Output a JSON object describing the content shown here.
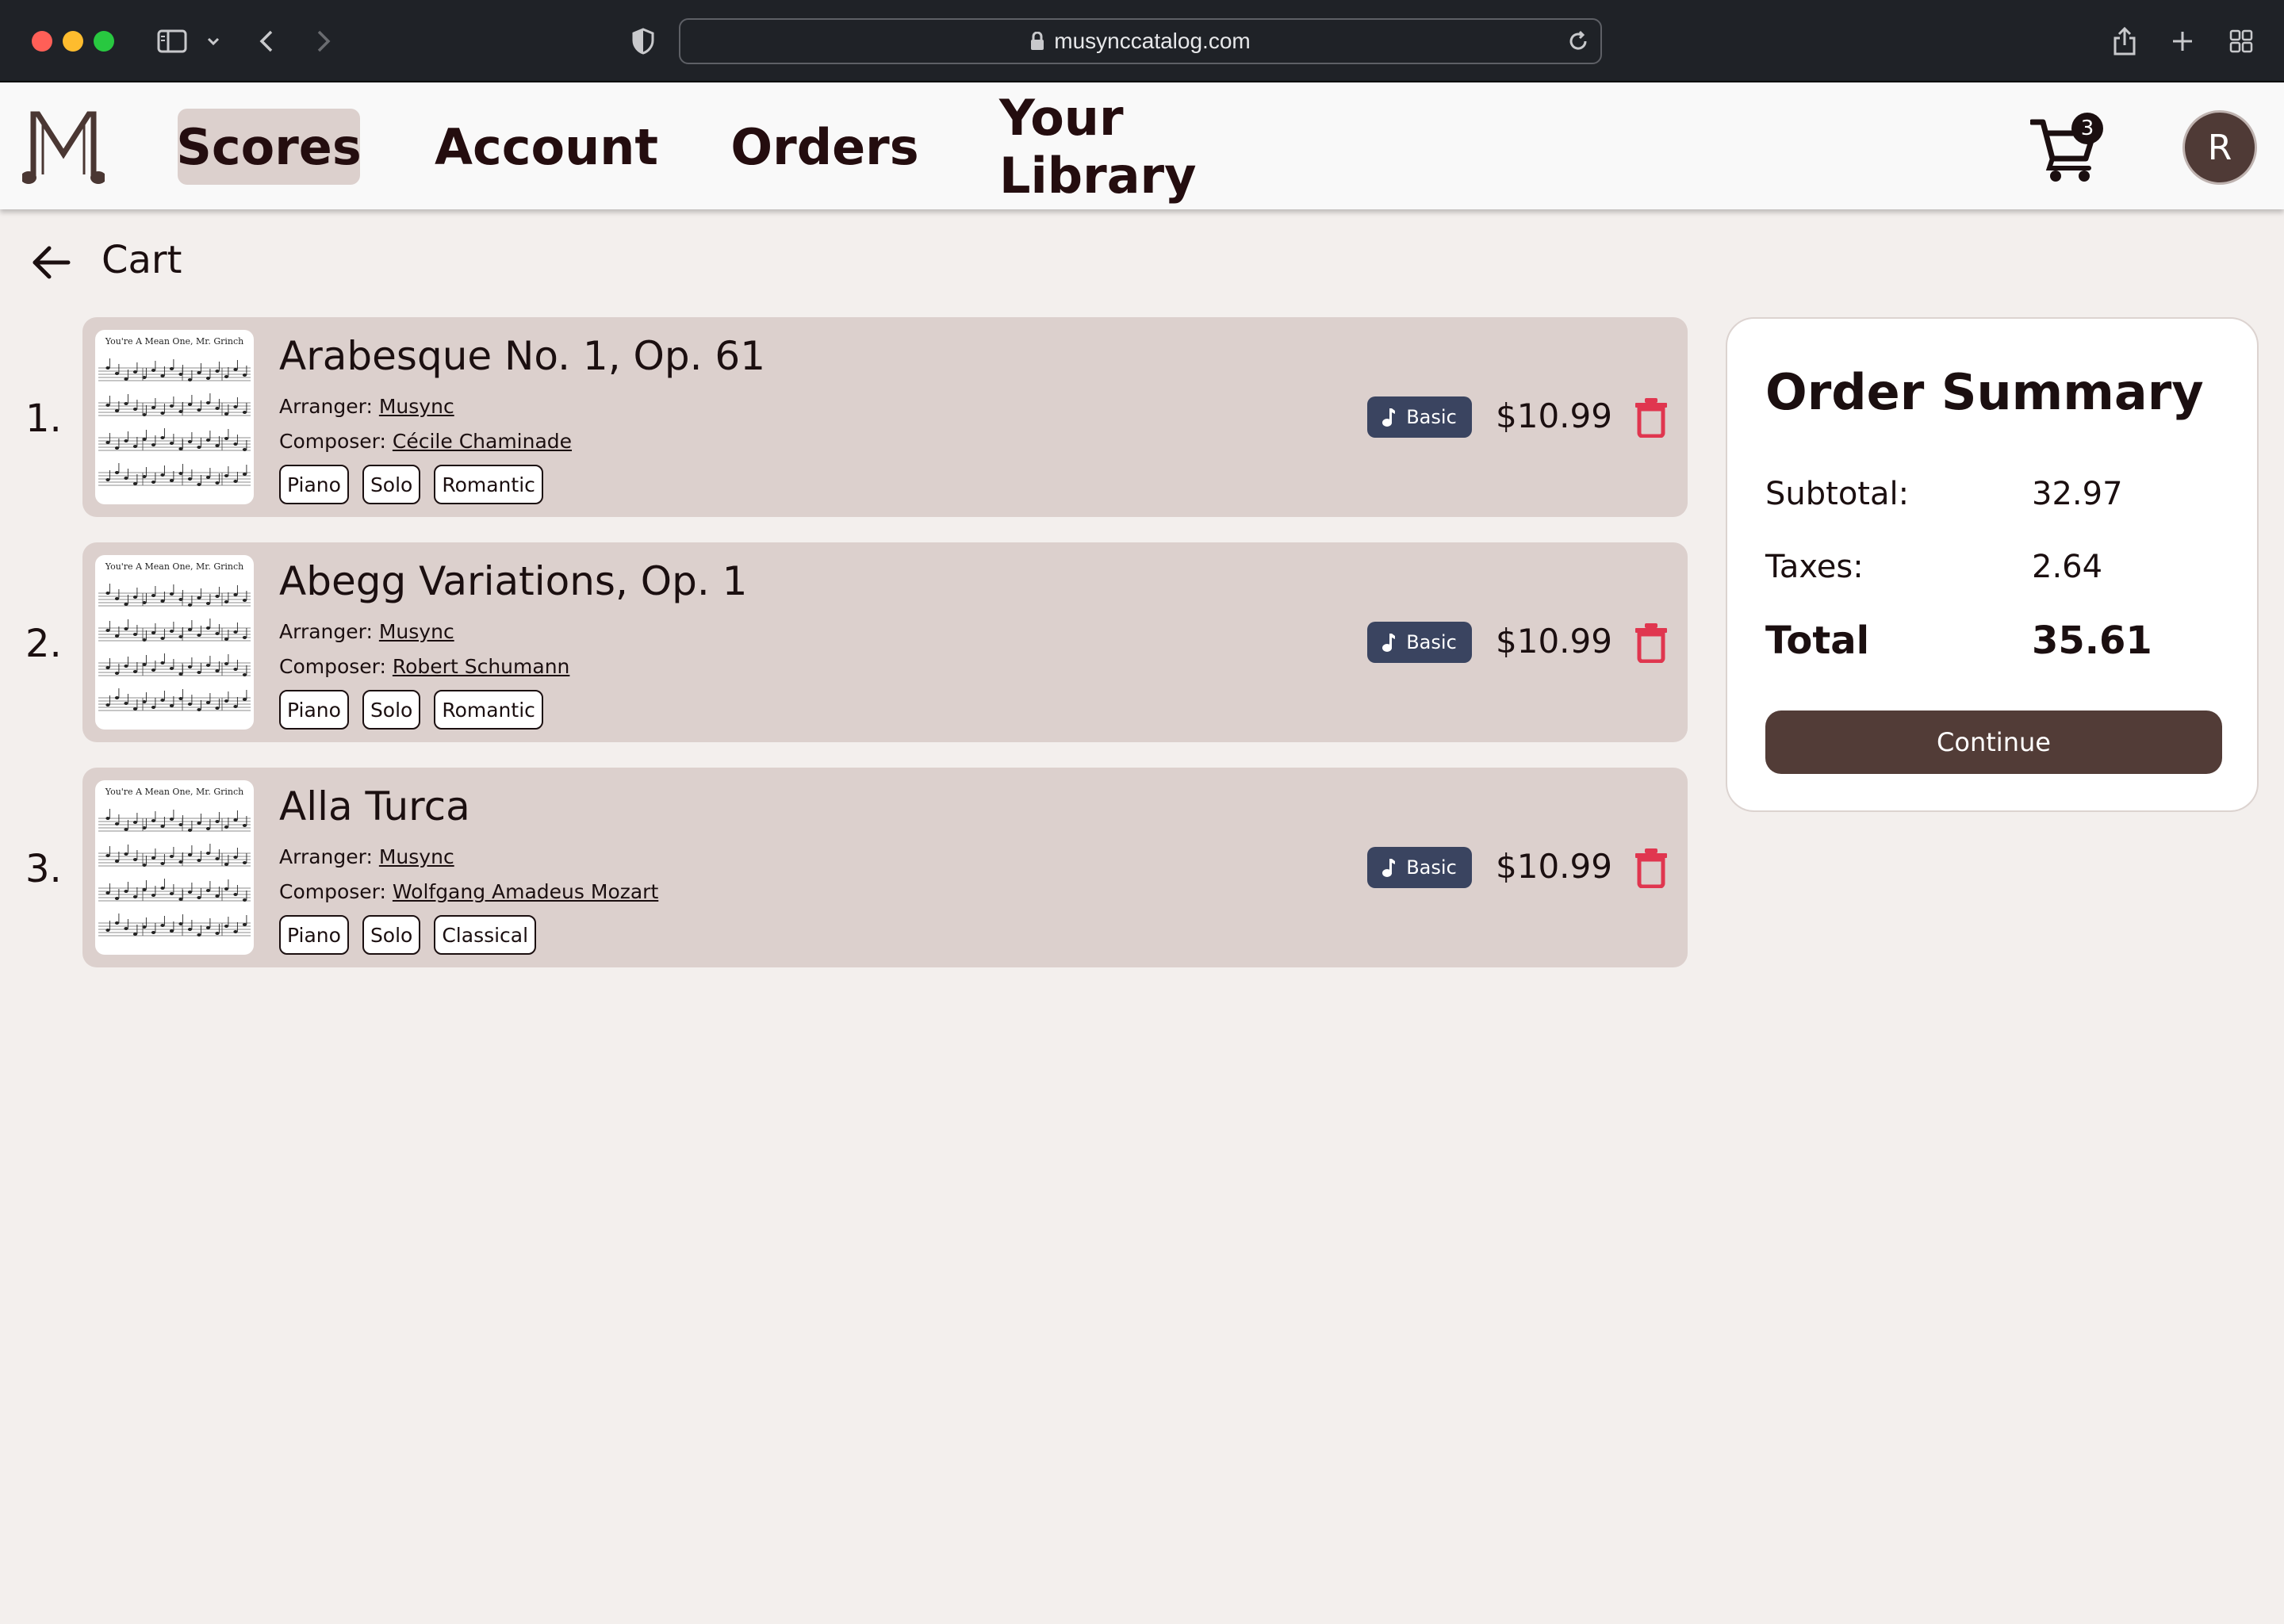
{
  "browser": {
    "url": "musynccatalog.com"
  },
  "nav": {
    "items": [
      {
        "label": "Scores",
        "active": true
      },
      {
        "label": "Account",
        "active": false
      },
      {
        "label": "Orders",
        "active": false
      },
      {
        "label": "Your Library",
        "active": false
      }
    ],
    "cart_count": "3",
    "avatar_initial": "R"
  },
  "page": {
    "title": "Cart"
  },
  "cart": {
    "items": [
      {
        "number": "1.",
        "title": "Arabesque No. 1, Op. 61",
        "arranger_label": "Arranger:",
        "arranger": "Musync",
        "composer_label": "Composer:",
        "composer": "Cécile Chaminade",
        "tags": [
          "Piano",
          "Solo",
          "Romantic"
        ],
        "tier": "Basic",
        "price": "$10.99"
      },
      {
        "number": "2.",
        "title": "Abegg Variations, Op. 1",
        "arranger_label": "Arranger:",
        "arranger": "Musync",
        "composer_label": "Composer:",
        "composer": "Robert Schumann",
        "tags": [
          "Piano",
          "Solo",
          "Romantic"
        ],
        "tier": "Basic",
        "price": "$10.99"
      },
      {
        "number": "3.",
        "title": "Alla Turca",
        "arranger_label": "Arranger:",
        "arranger": "Musync",
        "composer_label": "Composer:",
        "composer": "Wolfgang Amadeus Mozart",
        "tags": [
          "Piano",
          "Solo",
          "Classical"
        ],
        "tier": "Basic",
        "price": "$10.99"
      }
    ]
  },
  "summary": {
    "title": "Order Summary",
    "subtotal_label": "Subtotal:",
    "subtotal": "32.97",
    "taxes_label": "Taxes:",
    "taxes": "2.64",
    "total_label": "Total",
    "total": "35.61",
    "continue_label": "Continue"
  },
  "thumbnail": {
    "title": "You're A Mean One, Mr. Grinch"
  },
  "colors": {
    "accent": "#523c37",
    "card": "#dcd0cd",
    "tier_badge": "#3a4460",
    "delete": "#e0364f",
    "page_bg": "#f3efed"
  }
}
